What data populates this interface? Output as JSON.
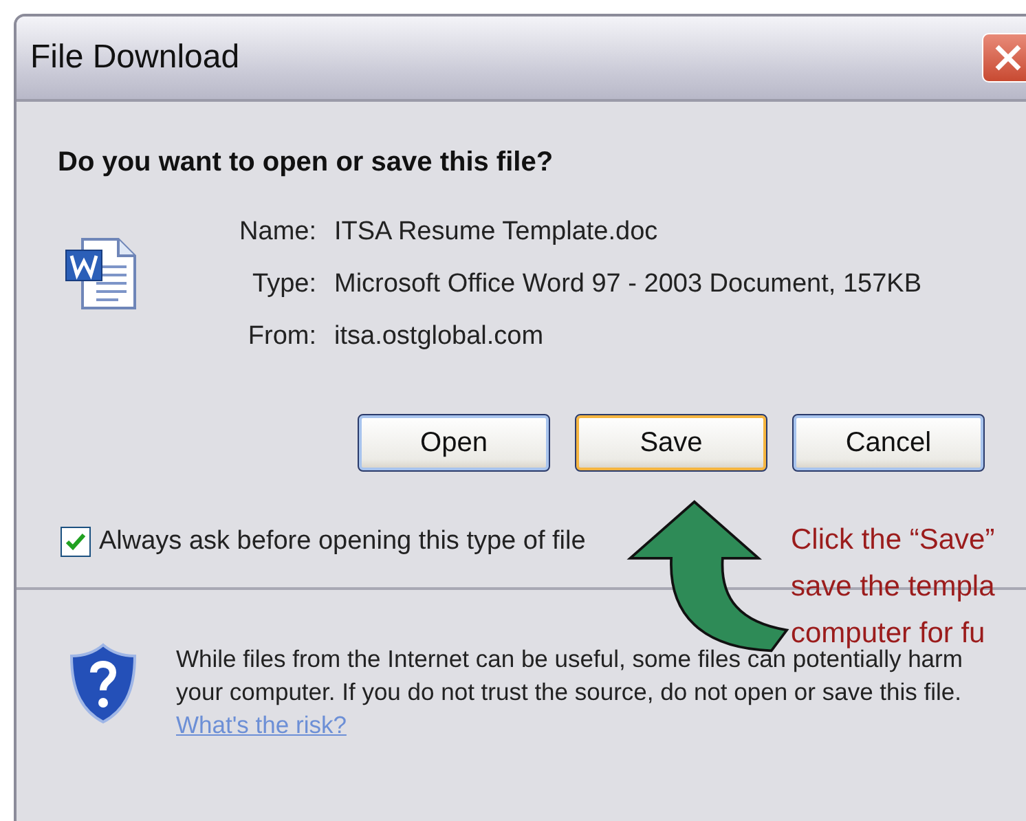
{
  "window": {
    "title": "File Download"
  },
  "question": "Do you want to open or save this file?",
  "file_info": [
    {
      "label": "Name:",
      "value": "ITSA Resume Template.doc"
    },
    {
      "label": "Type:",
      "value": "Microsoft Office Word 97 - 2003 Document, 157KB"
    },
    {
      "label": "From:",
      "value": "itsa.ostglobal.com"
    }
  ],
  "buttons": [
    {
      "label": "Open",
      "selected": false
    },
    {
      "label": "Save",
      "selected": true
    },
    {
      "label": "Cancel",
      "selected": false
    }
  ],
  "always_ask": {
    "label": "Always ask before opening this type of file",
    "checked": true
  },
  "warning": {
    "text": "While files from the Internet can be useful, some files can potentially harm your computer. If you do not trust the source, do not open or save this file.",
    "link": "What's the risk?"
  },
  "annotation": {
    "lines": [
      "Click the “Save”",
      "save the templa",
      "computer for fu"
    ]
  }
}
